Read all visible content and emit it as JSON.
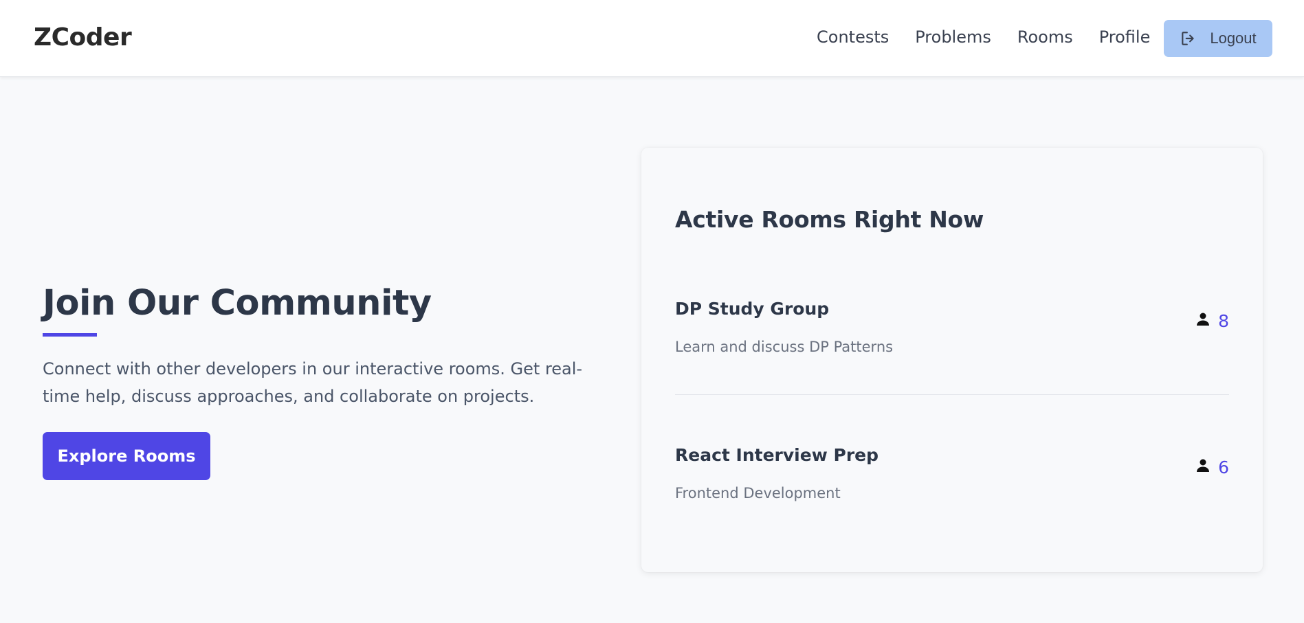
{
  "nav": {
    "brand": "ZCoder",
    "links": [
      "Contests",
      "Problems",
      "Rooms",
      "Profile"
    ],
    "logout_label": "Logout",
    "logout_icon": "logout-icon"
  },
  "hero": {
    "title": "Join Our Community",
    "description": "Connect with other developers in our interactive rooms. Get real-time help, discuss approaches, and collaborate on projects.",
    "cta_label": "Explore Rooms"
  },
  "rooms_card": {
    "title": "Active Rooms Right Now",
    "rooms": [
      {
        "name": "DP Study Group",
        "description": "Learn and discuss DP Patterns",
        "members": "8",
        "icon": "user-icon"
      },
      {
        "name": "React Interview Prep",
        "description": "Frontend Development",
        "members": "6",
        "icon": "user-icon"
      }
    ]
  },
  "colors": {
    "accent": "#4f46e5",
    "logout_bg": "#a9c8f5",
    "page_bg": "#f8f9fb"
  }
}
